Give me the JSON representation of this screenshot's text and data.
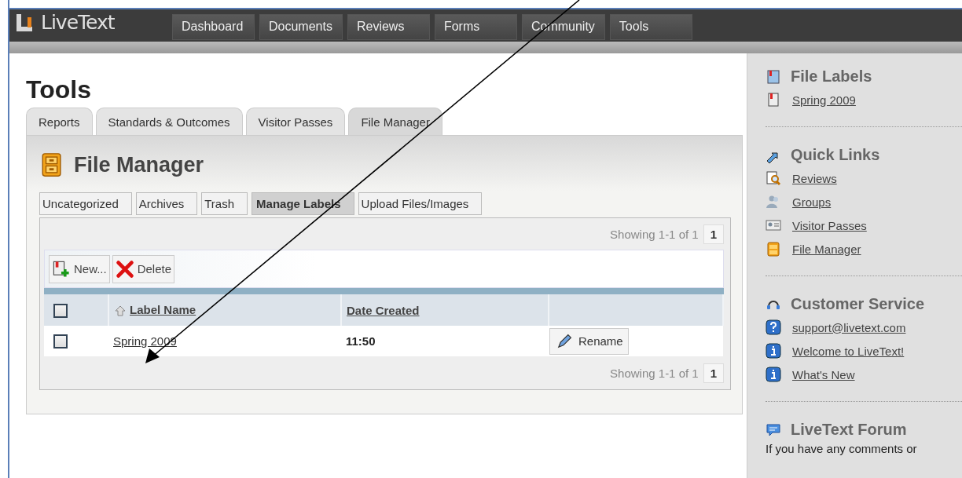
{
  "logo": {
    "text": "LiveText"
  },
  "nav": [
    {
      "label": "Dashboard",
      "selected": false
    },
    {
      "label": "Documents",
      "selected": false
    },
    {
      "label": "Reviews",
      "selected": false
    },
    {
      "label": "Forms",
      "selected": false
    },
    {
      "label": "Community",
      "selected": false
    },
    {
      "label": "Tools",
      "selected": false
    }
  ],
  "page_title": "Tools",
  "tabs": [
    {
      "label": "Reports",
      "selected": false
    },
    {
      "label": "Standards & Outcomes",
      "selected": false
    },
    {
      "label": "Visitor Passes",
      "selected": false
    },
    {
      "label": "File Manager",
      "selected": true
    }
  ],
  "panel": {
    "title": "File Manager",
    "subtabs": [
      {
        "label": "Uncategorized",
        "selected": false
      },
      {
        "label": "Archives",
        "selected": false
      },
      {
        "label": "Trash",
        "selected": false
      },
      {
        "label": "Manage Labels",
        "selected": true
      },
      {
        "label": "Upload Files/Images",
        "selected": false
      }
    ],
    "pager_top": {
      "text": "Showing 1-1 of 1",
      "page": "1"
    },
    "toolbar": [
      {
        "label": "New...",
        "kind": "new"
      },
      {
        "label": "Delete",
        "kind": "delete"
      }
    ],
    "table": {
      "select_all": {
        "checked": false
      },
      "columns": [
        {
          "label": "Label Name",
          "sorted": true
        },
        {
          "label": "Date Created",
          "sorted": false
        }
      ],
      "rows": [
        {
          "checked": false,
          "name": "Spring 2009",
          "date": "11:50",
          "action": "Rename"
        }
      ]
    },
    "pager_bottom": {
      "text": "Showing 1-1 of 1",
      "page": "1"
    }
  },
  "sidebar": {
    "sections": [
      {
        "title": "File Labels",
        "kind": "labels",
        "links": [
          {
            "kind": "label",
            "text": "Spring 2009"
          }
        ]
      },
      {
        "title": "Quick Links",
        "kind": "links",
        "links": [
          {
            "kind": "reviews",
            "text": "Reviews"
          },
          {
            "kind": "groups",
            "text": "Groups"
          },
          {
            "kind": "pass",
            "text": "Visitor Passes"
          },
          {
            "kind": "cabinet",
            "text": "File Manager"
          }
        ]
      },
      {
        "title": "Customer Service",
        "kind": "headset",
        "links": [
          {
            "kind": "help",
            "text": "support@livetext.com"
          },
          {
            "kind": "info",
            "text": "Welcome to LiveText!"
          },
          {
            "kind": "info",
            "text": "What's New"
          }
        ]
      },
      {
        "title": "LiveText Forum",
        "kind": "forum",
        "text": "If you have any comments or"
      }
    ]
  }
}
